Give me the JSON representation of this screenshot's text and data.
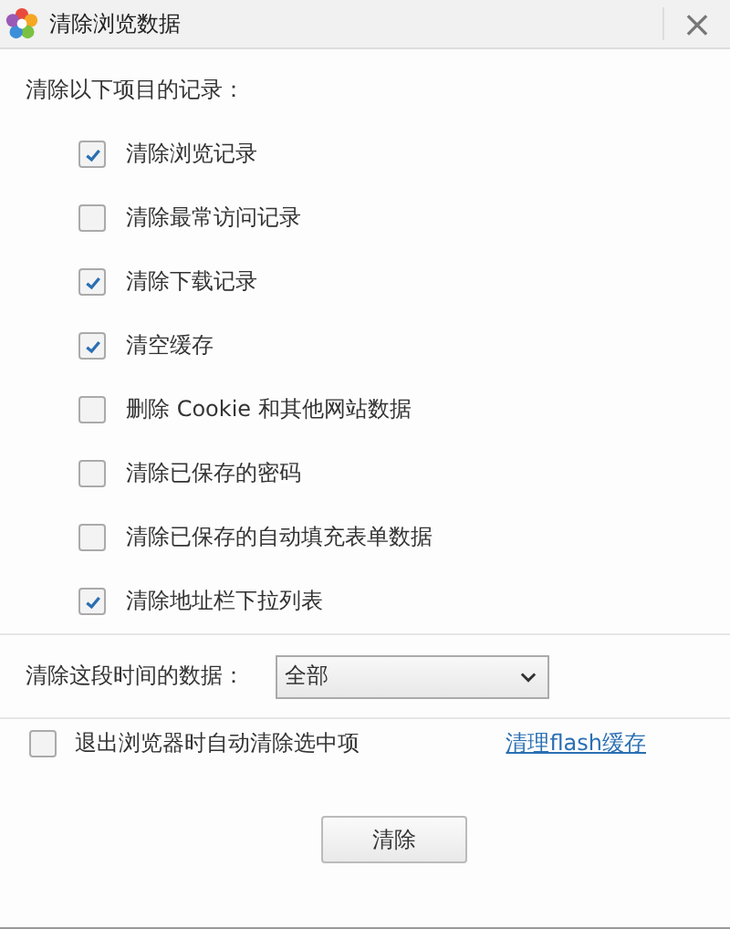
{
  "window": {
    "title": "清除浏览数据",
    "close": "×"
  },
  "heading": "清除以下项目的记录：",
  "options": [
    {
      "label": "清除浏览记录",
      "checked": true
    },
    {
      "label": "清除最常访问记录",
      "checked": false
    },
    {
      "label": "清除下载记录",
      "checked": true
    },
    {
      "label": "清空缓存",
      "checked": true
    },
    {
      "label": "删除 Cookie 和其他网站数据",
      "checked": false
    },
    {
      "label": "清除已保存的密码",
      "checked": false
    },
    {
      "label": "清除已保存的自动填充表单数据",
      "checked": false
    },
    {
      "label": "清除地址栏下拉列表",
      "checked": true
    }
  ],
  "time_range": {
    "label": "清除这段时间的数据：",
    "value": "全部"
  },
  "auto_clear": {
    "label": "退出浏览器时自动清除选中项",
    "checked": false
  },
  "flash_link": "清理flash缓存",
  "clear_button": "清除"
}
